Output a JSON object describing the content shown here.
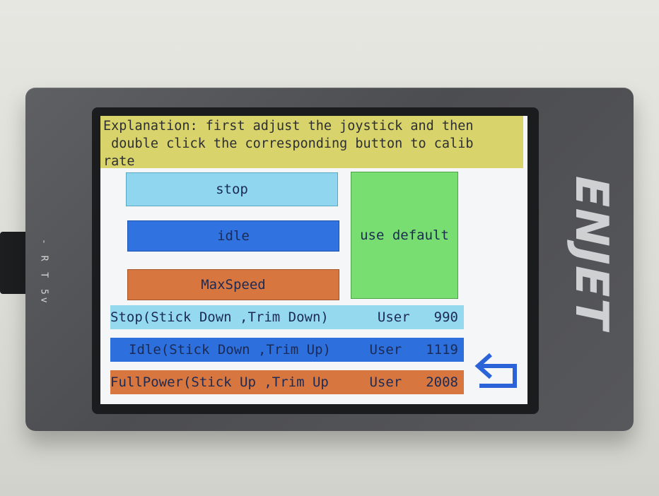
{
  "device": {
    "side_label": "- R T 5v",
    "logo_text": "ENJET"
  },
  "screen": {
    "explanation": "Explanation: first adjust the joystick and then\n double click the corresponding button to calib\nrate",
    "buttons": {
      "stop": "stop",
      "idle": "idle",
      "max_speed": "MaxSpeed",
      "use_default": "use default"
    },
    "rows": [
      {
        "label": "Stop(Stick Down ,Trim Down)",
        "user": "User",
        "value": "990"
      },
      {
        "label": "Idle(Stick Down ,Trim Up)",
        "user": "User",
        "value": "1119"
      },
      {
        "label": "FullPower(Stick Up ,Trim Up",
        "user": "User",
        "value": "2008"
      }
    ],
    "back_icon": "back-arrow-icon"
  },
  "colors": {
    "explanation_bg": "#d8d36a",
    "stop": "#8fd6ee",
    "idle": "#2f72e0",
    "max_speed": "#d8763f",
    "use_default": "#79de71",
    "back_icon": "#2b63d9"
  }
}
